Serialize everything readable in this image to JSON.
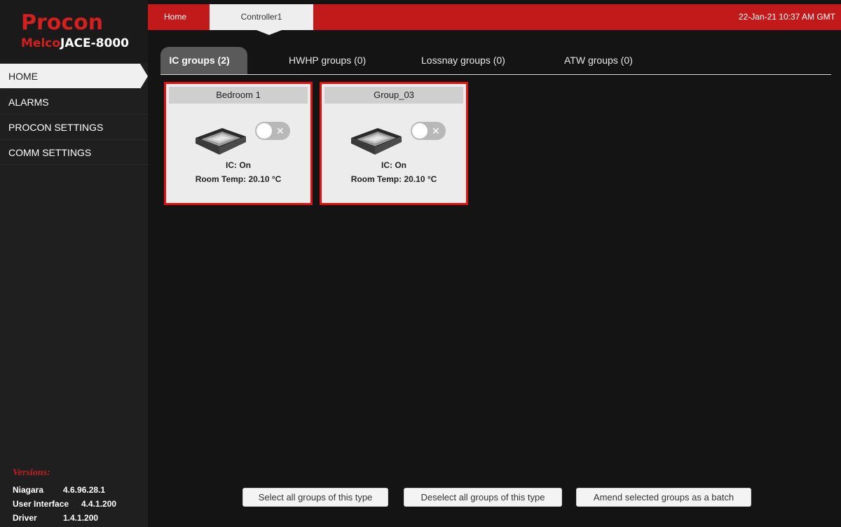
{
  "brand": {
    "name": "Procon",
    "product_prefix": "Melco",
    "product_suffix": "JACE-8000"
  },
  "sidebar": {
    "items": [
      {
        "label": "HOME",
        "active": true
      },
      {
        "label": "ALARMS",
        "active": false
      },
      {
        "label": "PROCON SETTINGS",
        "active": false
      },
      {
        "label": "COMM SETTINGS",
        "active": false
      }
    ]
  },
  "versions": {
    "title": "Versions:",
    "rows": [
      {
        "name": "Niagara",
        "value": "4.6.96.28.1"
      },
      {
        "name": "User Interface",
        "value": "4.4.1.200"
      },
      {
        "name": "Driver",
        "value": "1.4.1.200"
      }
    ]
  },
  "topbar": {
    "home_tab": "Home",
    "controller_tab": "Controller1",
    "datetime": "22-Jan-21 10:37 AM GMT"
  },
  "group_tabs": [
    {
      "label": "IC groups (2)",
      "active": true
    },
    {
      "label": "HWHP groups (0)",
      "active": false
    },
    {
      "label": "Lossnay groups (0)",
      "active": false
    },
    {
      "label": "ATW groups (0)",
      "active": false
    }
  ],
  "groups": [
    {
      "name": "Bedroom 1",
      "status": "IC: On",
      "temp": "Room Temp: 20.10 °C",
      "toggle_symbol": "✕",
      "icon": "cassette-unit-icon"
    },
    {
      "name": "Group_03",
      "status": "IC: On",
      "temp": "Room Temp: 20.10 °C",
      "toggle_symbol": "✕",
      "icon": "cassette-unit-icon"
    }
  ],
  "actions": {
    "select_all": "Select all groups of this type",
    "deselect_all": "Deselect all groups of this type",
    "amend_batch": "Amend selected groups as a batch"
  },
  "colors": {
    "accent_red": "#c21a1a",
    "selected_border": "#e01212",
    "background": "#141414",
    "sidebar": "#1f1f1f"
  }
}
